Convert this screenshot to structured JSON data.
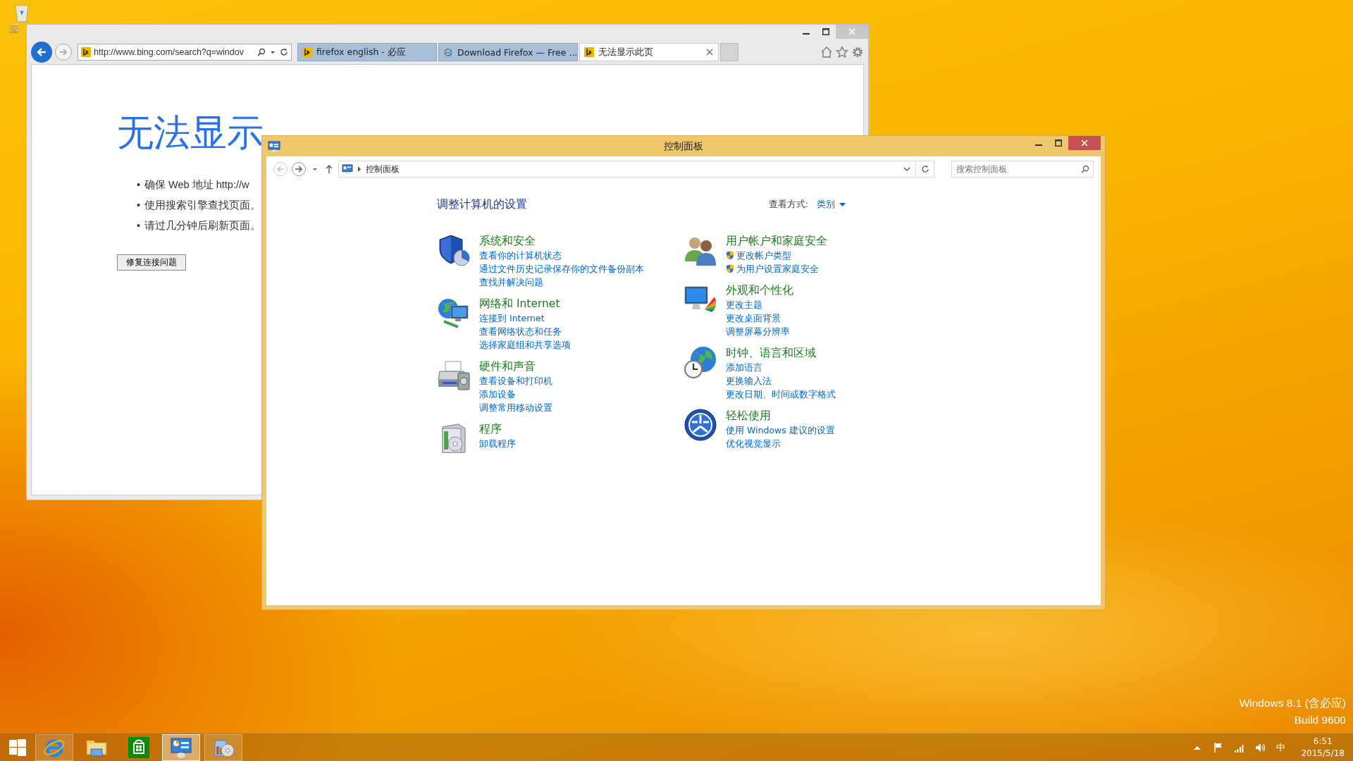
{
  "desktop": {
    "icons": [
      {
        "label": "回"
      }
    ],
    "watermark": [
      "Windows 8.1 (含必应)",
      "Build 9600"
    ]
  },
  "browser": {
    "address": "http://www.bing.com/search?q=windov",
    "tabs": [
      {
        "title": "firefox english - 必应",
        "kind": "bing",
        "selected": false
      },
      {
        "title": "Download Firefox — Free ...",
        "kind": "ie",
        "selected": false
      },
      {
        "title": "无法显示此页",
        "kind": "bing",
        "selected": true
      }
    ],
    "page": {
      "heading": "无法显示",
      "marker": "•",
      "bullets": [
        "确保 Web 地址 http://w",
        "使用搜索引擎查找页面。",
        "请过几分钟后刷新页面。"
      ],
      "button": "修复连接问题"
    }
  },
  "control_panel": {
    "title": "控制面板",
    "breadcrumb": "控制面板",
    "search": {
      "placeholder": "搜索控制面板"
    },
    "heading": "调整计算机的设置",
    "view_by": {
      "label": "查看方式:",
      "value": "类别"
    },
    "columns": [
      {
        "categories": [
          {
            "title": "系统和安全",
            "kind": "security",
            "links": [
              {
                "text": "查看你的计算机状态",
                "shield": false
              },
              {
                "text": "通过文件历史记录保存你的文件备份副本",
                "shield": false
              },
              {
                "text": "查找并解决问题",
                "shield": false
              }
            ]
          },
          {
            "title": "网络和 Internet",
            "kind": "network",
            "links": [
              {
                "text": "连接到 Internet",
                "shield": false
              },
              {
                "text": "查看网络状态和任务",
                "shield": false
              },
              {
                "text": "选择家庭组和共享选项",
                "shield": false
              }
            ]
          },
          {
            "title": "硬件和声音",
            "kind": "hardware",
            "links": [
              {
                "text": "查看设备和打印机",
                "shield": false
              },
              {
                "text": "添加设备",
                "shield": false
              },
              {
                "text": "调整常用移动设置",
                "shield": false
              }
            ]
          },
          {
            "title": "程序",
            "kind": "programs",
            "links": [
              {
                "text": "卸载程序",
                "shield": false
              }
            ]
          }
        ]
      },
      {
        "categories": [
          {
            "title": "用户帐户和家庭安全",
            "kind": "users",
            "links": [
              {
                "text": "更改帐户类型",
                "shield": true
              },
              {
                "text": "为用户设置家庭安全",
                "shield": true
              }
            ]
          },
          {
            "title": "外观和个性化",
            "kind": "appearance",
            "links": [
              {
                "text": "更改主题",
                "shield": false
              },
              {
                "text": "更改桌面背景",
                "shield": false
              },
              {
                "text": "调整屏幕分辨率",
                "shield": false
              }
            ]
          },
          {
            "title": "时钟、语言和区域",
            "kind": "clock",
            "links": [
              {
                "text": "添加语言",
                "shield": false
              },
              {
                "text": "更换输入法",
                "shield": false
              },
              {
                "text": "更改日期、时间或数字格式",
                "shield": false
              }
            ]
          },
          {
            "title": "轻松使用",
            "kind": "ease",
            "links": [
              {
                "text": "使用 Windows 建议的设置",
                "shield": false
              },
              {
                "text": "优化视觉显示",
                "shield": false
              }
            ]
          }
        ]
      }
    ]
  },
  "taskbar": {
    "apps": [
      {
        "kind": "ie",
        "running": true,
        "selected": false
      },
      {
        "kind": "explorer",
        "running": false,
        "selected": false
      },
      {
        "kind": "store",
        "running": false,
        "selected": false
      },
      {
        "kind": "control_panel",
        "running": true,
        "selected": true
      },
      {
        "kind": "installer",
        "running": true,
        "selected": false
      }
    ],
    "ime": "中",
    "clock": {
      "time": "6:51",
      "date": "2015/5/18"
    }
  }
}
